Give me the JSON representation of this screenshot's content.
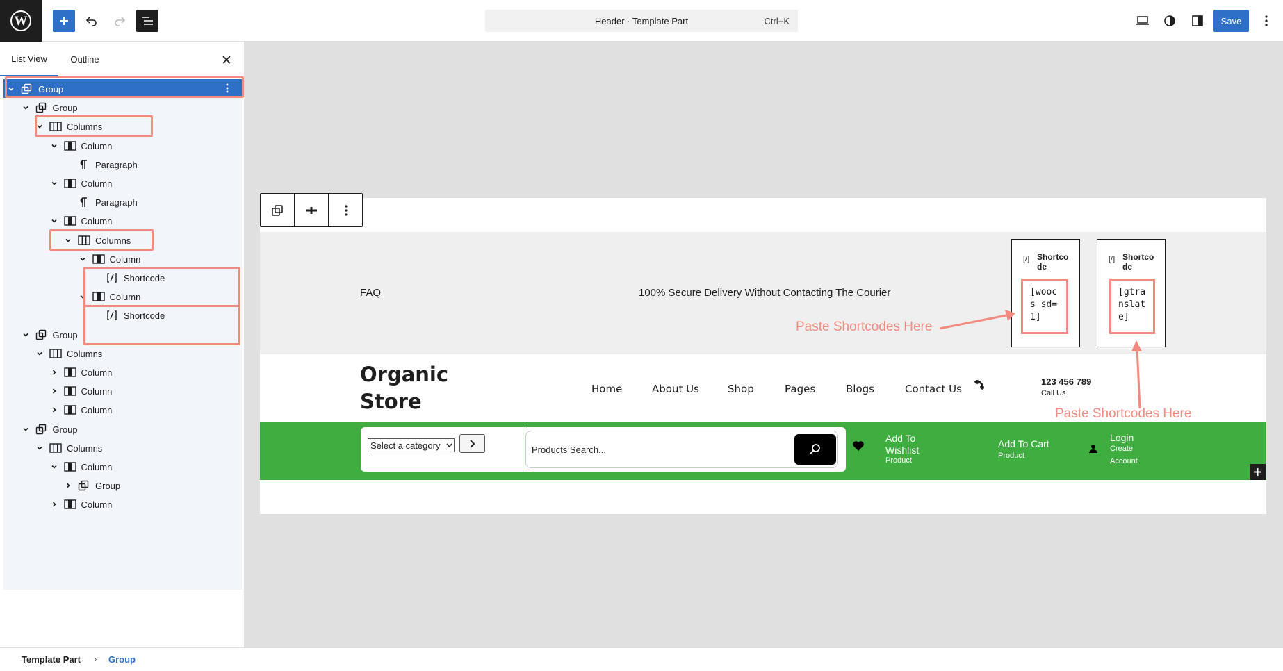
{
  "topbar": {
    "command_title": "Header · Template Part",
    "command_shortcut": "Ctrl+K",
    "save_label": "Save"
  },
  "panel": {
    "tabs": [
      "List View",
      "Outline"
    ],
    "tree": [
      {
        "label": "Group",
        "icon": "group-icon",
        "chevron": "down",
        "selected": true
      },
      {
        "label": "Group",
        "icon": "group-icon",
        "chevron": "down"
      },
      {
        "label": "Columns",
        "icon": "columns-icon",
        "chevron": "down"
      },
      {
        "label": "Column",
        "icon": "column-icon",
        "chevron": "down"
      },
      {
        "label": "Paragraph",
        "icon": "paragraph-icon",
        "chevron": "none"
      },
      {
        "label": "Column",
        "icon": "column-icon",
        "chevron": "down"
      },
      {
        "label": "Paragraph",
        "icon": "paragraph-icon",
        "chevron": "none"
      },
      {
        "label": "Column",
        "icon": "column-icon",
        "chevron": "down"
      },
      {
        "label": "Columns",
        "icon": "columns-icon",
        "chevron": "down"
      },
      {
        "label": "Column",
        "icon": "column-icon",
        "chevron": "down"
      },
      {
        "label": "Shortcode",
        "icon": "shortcode-icon",
        "chevron": "none"
      },
      {
        "label": "Column",
        "icon": "column-icon",
        "chevron": "down"
      },
      {
        "label": "Shortcode",
        "icon": "shortcode-icon",
        "chevron": "none"
      },
      {
        "label": "Group",
        "icon": "group-icon",
        "chevron": "down"
      },
      {
        "label": "Columns",
        "icon": "columns-icon",
        "chevron": "down"
      },
      {
        "label": "Column",
        "icon": "column-icon",
        "chevron": "right"
      },
      {
        "label": "Column",
        "icon": "column-icon",
        "chevron": "right"
      },
      {
        "label": "Column",
        "icon": "column-icon",
        "chevron": "right"
      },
      {
        "label": "Group",
        "icon": "group-icon",
        "chevron": "down"
      },
      {
        "label": "Columns",
        "icon": "columns-icon",
        "chevron": "down"
      },
      {
        "label": "Column",
        "icon": "column-icon",
        "chevron": "down"
      },
      {
        "label": "Group",
        "icon": "group-icon",
        "chevron": "right"
      },
      {
        "label": "Column",
        "icon": "column-icon",
        "chevron": "right"
      }
    ]
  },
  "breadcrumb": {
    "root": "Template Part",
    "current": "Group"
  },
  "header_preview": {
    "faq": "FAQ",
    "secure_text": "100% Secure Delivery Without Contacting The Courier",
    "shortcode_title": "Shortcode",
    "shortcode_1": "[woocs sd=1]",
    "shortcode_2": "[gtranslate]",
    "annotation": "Paste Shortcodes Here",
    "logo_line1": "Organic",
    "logo_line2": "Store",
    "nav": [
      "Home",
      "About Us",
      "Shop",
      "Pages",
      "Blogs",
      "Contact Us"
    ],
    "phone": "123 456 789",
    "phone_sub": "Call Us",
    "category_select": "Select a category",
    "search_placeholder": "Products Search...",
    "wishlist_title": "Add To Wishlist",
    "wishlist_sub": "Product",
    "cart_title": "Add To Cart",
    "cart_sub": "Product",
    "login_title": "Login",
    "login_sub1": "Create",
    "login_sub2": "Account"
  },
  "colors": {
    "accent": "#2e6fc7",
    "highlight": "#f28a80",
    "green": "#3fad3f"
  }
}
